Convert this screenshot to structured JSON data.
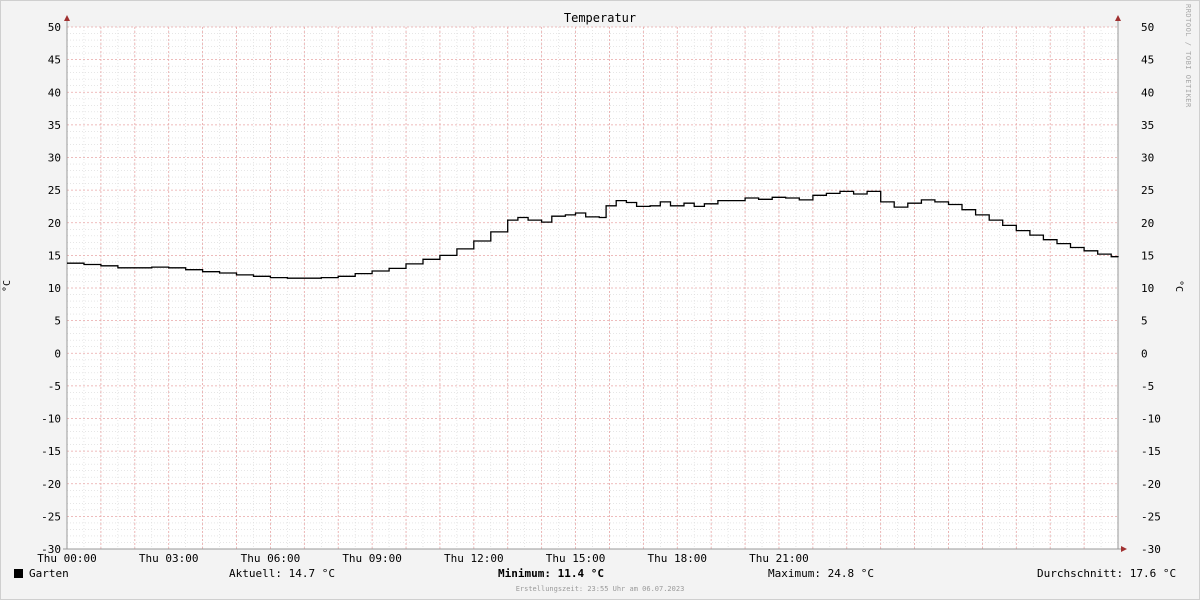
{
  "chart_data": {
    "type": "line",
    "title": "Temperatur",
    "ylabel": "°C",
    "ylim": [
      -30,
      50
    ],
    "yticks": [
      50,
      45,
      40,
      35,
      30,
      25,
      20,
      15,
      10,
      5,
      0,
      -5,
      -10,
      -15,
      -20,
      -25,
      -30
    ],
    "xlim": [
      0,
      24
    ],
    "xticks": [
      {
        "hour": 0,
        "label": "Thu 00:00"
      },
      {
        "hour": 3,
        "label": "Thu 03:00"
      },
      {
        "hour": 6,
        "label": "Thu 06:00"
      },
      {
        "hour": 9,
        "label": "Thu 09:00"
      },
      {
        "hour": 12,
        "label": "Thu 12:00"
      },
      {
        "hour": 15,
        "label": "Thu 15:00"
      },
      {
        "hour": 18,
        "label": "Thu 18:00"
      },
      {
        "hour": 21,
        "label": "Thu 21:00"
      }
    ],
    "grid": true,
    "series": [
      {
        "name": "Garten",
        "color": "#000000",
        "points": [
          [
            0.0,
            13.8
          ],
          [
            0.5,
            13.6
          ],
          [
            1.0,
            13.4
          ],
          [
            1.5,
            13.1
          ],
          [
            2.0,
            13.1
          ],
          [
            2.5,
            13.2
          ],
          [
            3.0,
            13.1
          ],
          [
            3.5,
            12.8
          ],
          [
            4.0,
            12.5
          ],
          [
            4.5,
            12.3
          ],
          [
            5.0,
            12.0
          ],
          [
            5.5,
            11.8
          ],
          [
            6.0,
            11.6
          ],
          [
            6.5,
            11.5
          ],
          [
            7.0,
            11.5
          ],
          [
            7.5,
            11.6
          ],
          [
            8.0,
            11.8
          ],
          [
            8.5,
            12.2
          ],
          [
            9.0,
            12.6
          ],
          [
            9.5,
            13.0
          ],
          [
            10.0,
            13.7
          ],
          [
            10.5,
            14.4
          ],
          [
            11.0,
            15.0
          ],
          [
            11.5,
            16.0
          ],
          [
            12.0,
            17.2
          ],
          [
            12.5,
            18.6
          ],
          [
            13.0,
            20.4
          ],
          [
            13.3,
            20.8
          ],
          [
            13.6,
            20.4
          ],
          [
            14.0,
            20.1
          ],
          [
            14.3,
            21.0
          ],
          [
            14.7,
            21.2
          ],
          [
            15.0,
            21.5
          ],
          [
            15.3,
            20.9
          ],
          [
            15.7,
            20.8
          ],
          [
            15.9,
            22.6
          ],
          [
            16.2,
            23.4
          ],
          [
            16.5,
            23.1
          ],
          [
            16.8,
            22.5
          ],
          [
            17.2,
            22.6
          ],
          [
            17.5,
            23.2
          ],
          [
            17.8,
            22.6
          ],
          [
            18.2,
            23.0
          ],
          [
            18.5,
            22.5
          ],
          [
            18.8,
            22.9
          ],
          [
            19.2,
            23.4
          ],
          [
            19.6,
            23.4
          ],
          [
            20.0,
            23.8
          ],
          [
            20.4,
            23.6
          ],
          [
            20.8,
            23.9
          ],
          [
            21.2,
            23.8
          ],
          [
            21.6,
            23.5
          ],
          [
            22.0,
            24.2
          ],
          [
            22.4,
            24.5
          ],
          [
            22.8,
            24.8
          ],
          [
            23.2,
            24.4
          ],
          [
            23.6,
            24.8
          ],
          [
            24.0,
            23.2
          ],
          [
            24.4,
            22.4
          ],
          [
            24.8,
            23.0
          ],
          [
            25.2,
            23.5
          ],
          [
            25.6,
            23.2
          ],
          [
            26.0,
            22.8
          ],
          [
            26.4,
            22.0
          ],
          [
            26.8,
            21.2
          ],
          [
            27.2,
            20.4
          ],
          [
            27.6,
            19.6
          ],
          [
            28.0,
            18.8
          ],
          [
            28.4,
            18.1
          ],
          [
            28.8,
            17.4
          ],
          [
            29.2,
            16.8
          ],
          [
            29.6,
            16.2
          ],
          [
            30.0,
            15.7
          ],
          [
            30.4,
            15.2
          ],
          [
            30.8,
            14.8
          ],
          [
            31.0,
            14.7
          ]
        ]
      }
    ],
    "legend": {
      "series_label": "Garten",
      "current": "Aktuell: 14.7 °C",
      "minimum": "Minimum: 11.4 °C",
      "maximum": "Maximum: 24.8 °C",
      "average": "Durchschnitt: 17.6 °C"
    }
  },
  "watermark": "RRDTOOL / TOBI OETIKER",
  "footer": "Erstellungszeit: 23:55 Uhr am 06.07.2023",
  "colors": {
    "background": "#f3f3f3",
    "plot_background": "#ffffff",
    "major_grid": "#e9a6a6",
    "minor_grid": "#d8d8d8",
    "axis_arrow": "#a03030",
    "line": "#000000"
  }
}
